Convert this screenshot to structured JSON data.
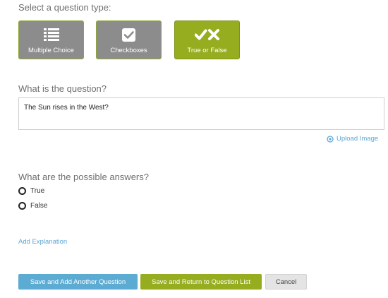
{
  "type_section": {
    "label": "Select a question type:",
    "options": [
      {
        "label": "Multiple Choice",
        "icon": "list-icon",
        "active": false
      },
      {
        "label": "Checkboxes",
        "icon": "checkbox-icon",
        "active": false
      },
      {
        "label": "True or False",
        "icon": "check-cross-icon",
        "active": true
      }
    ]
  },
  "question_section": {
    "label": "What is the question?",
    "value": "The Sun rises in the West?",
    "upload_label": "Upload Image"
  },
  "answers_section": {
    "label": "What are the possible answers?",
    "answers": [
      {
        "label": "True"
      },
      {
        "label": "False"
      }
    ]
  },
  "add_explanation_label": "Add Explanation",
  "buttons": {
    "save_add": "Save and Add Another Question",
    "save_return": "Save and Return to Question List",
    "cancel": "Cancel"
  },
  "colors": {
    "active_tile": "#95ad1f",
    "inactive_tile": "#8c8c8c",
    "link": "#5aa6d6",
    "primary_blue": "#5cabd3"
  }
}
